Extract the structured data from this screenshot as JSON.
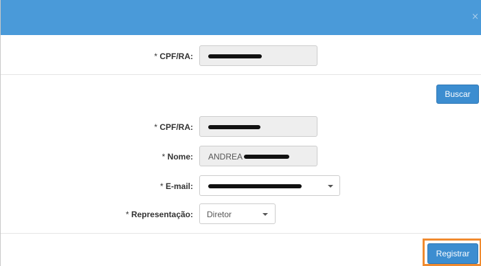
{
  "header": {
    "close_label": "×",
    "close_icon": "close-icon"
  },
  "search": {
    "cpf_label": "CPF/RA:",
    "required_mark": "* ",
    "button_label": "Buscar"
  },
  "form": {
    "cpf_label": "CPF/RA:",
    "nome_label": "Nome:",
    "nome_value": "ANDREA",
    "email_label": "E-mail:",
    "representacao_label": "Representação:",
    "representacao_value": "Diretor",
    "required_mark": "* "
  },
  "footer": {
    "register_label": "Registrar"
  },
  "colors": {
    "header": "#4a9ad9",
    "button": "#3c8dd0",
    "highlight": "#f08a2e"
  }
}
